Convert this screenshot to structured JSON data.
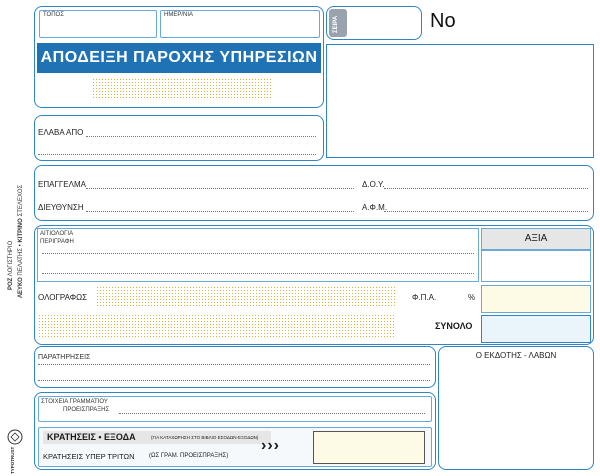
{
  "header": {
    "place_label": "ΤΟΠΟΣ",
    "date_label": "ΗΜΕΡ/ΝΙΑ",
    "title": "ΑΠΟΔΕΙΞΗ ΠΑΡΟΧΗΣ ΥΠΗΡΕΣΙΩΝ",
    "series_label": "ΣΕΙΡΑ",
    "number_label": "No"
  },
  "payer": {
    "received_from_label": "ΕΛΑΒΑ ΑΠΟ",
    "profession_label": "ΕΠΑΓΓΕΛΜΑ",
    "tax_office_label": "Δ.Ο.Υ.",
    "address_label": "ΔΙΕΥΘΥΝΣΗ",
    "vat_number_label": "Α.Φ.Μ."
  },
  "services": {
    "reason_label_line1": "ΑΙΤΙΟΛΟΓΙΑ",
    "reason_label_line2": "ΠΕΡΙΓΡΑΦΗ",
    "value_header": "ΑΞΙΑ",
    "in_words_label": "ΟΛΟΓΡΑΦΩΣ",
    "vat_label": "Φ.Π.Α.",
    "percent_sign": "%",
    "total_label": "ΣΥΝΟΛΟ",
    "remarks_label": "ΠΑΡΑΤΗΡΗΣΕΙΣ"
  },
  "side": {
    "copies_line1_prefix": "ΡΟΖ",
    "copies_line1_text": "ΛΟΓΙΣΤΗΡΙΟ",
    "copies_line2_a_prefix": "ΛΕΥΚΟ",
    "copies_line2_a_text": "ΠΕΛΑΤΗΣ",
    "copies_line2_b_prefix": "ΚΙΤΡΙΝΟ",
    "copies_line2_b_text": "ΣΤΕΛΕΧΟΣ",
    "bullet": "•",
    "brand": "TYPOTRUST"
  },
  "footer": {
    "issuer_receiver_label": "Ο ΕΚΔΟΤΗΣ - ΛΑΒΩΝ",
    "secretary_label_line1": "ΣΤΟΙΧΕΙΑ ΓΡΑΜΜΑΤΙΟΥ",
    "secretary_label_line2": "ΠΡΟΕΙΣΠΡΑΞΗΣ",
    "withholdings_label": "ΚΡΑΤΗΣΕΙΣ • ΕΞΟΔΑ",
    "withholdings_note": "(ΓΙΑ ΚΑΤΑΧΩΡΗΣΗ ΣΤΟ ΒΙΒΛΙΟ ΕΣΟΔΩΝ-ΕΞΟΔΩΝ)",
    "third_party_label": "ΚΡΑΤΗΣΕΙΣ ΥΠΕΡ ΤΡΙΤΩΝ",
    "third_party_note": "(ΩΣ ΓΡΑΜ. ΠΡΟΕΙΣΠΡΑΞΗΣ)",
    "arrows": "›››"
  }
}
